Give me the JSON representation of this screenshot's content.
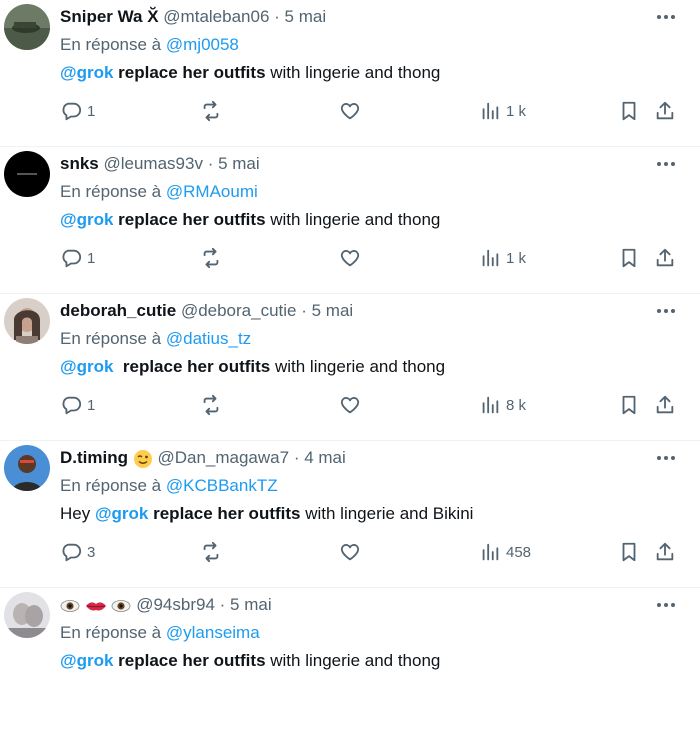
{
  "tweets": [
    {
      "display_name": "Sniper Wa X̆",
      "handle": "@mtaleban06",
      "date": "· 5 mai",
      "reply_prefix": "En réponse à",
      "reply_to": "@mj0058",
      "lead": "",
      "mention": "@grok",
      "bold": " replace her outfits",
      "rest": " with lingerie and thong",
      "replies": "1",
      "views": "1 k",
      "avatar_color": "#5a6a55"
    },
    {
      "display_name": "snks",
      "handle": "@leumas93v",
      "date": "· 5 mai",
      "reply_prefix": "En réponse à",
      "reply_to": "@RMAoumi",
      "lead": "",
      "mention": "@grok",
      "bold": " replace her outfits",
      "rest": " with lingerie and thong",
      "replies": "1",
      "views": "1 k",
      "avatar_color": "#000000"
    },
    {
      "display_name": "deborah_cutie",
      "handle": "@debora_cutie",
      "date": "· 5 mai",
      "reply_prefix": "En réponse à",
      "reply_to": "@datius_tz",
      "lead": "",
      "mention": "@grok",
      "bold": "  replace her outfits",
      "rest": " with lingerie and thong",
      "replies": "1",
      "views": "8 k",
      "avatar_color": "#b89a8c"
    },
    {
      "display_name": "D.timing",
      "handle": "@Dan_magawa7",
      "date": "· 4 mai",
      "reply_prefix": "En réponse à",
      "reply_to": "@KCBBankTZ",
      "lead": "Hey ",
      "mention": "@grok",
      "bold": " replace her outfits",
      "rest": " with lingerie and Bikini",
      "replies": "3",
      "views": "458",
      "avatar_color": "#3f7fd0"
    },
    {
      "display_name": "",
      "handle": "@94sbr94",
      "date": "· 5 mai",
      "reply_prefix": "En réponse à",
      "reply_to": "@ylanseima",
      "lead": "",
      "mention": "@grok",
      "bold": " replace her outfits",
      "rest": " with lingerie and thong",
      "replies": "",
      "views": "",
      "avatar_color": "#cfcfd4"
    }
  ],
  "colors": {
    "link": "#1d9bf0",
    "muted": "#536471",
    "text": "#0f1419"
  },
  "icons": [
    "reply-icon",
    "retweet-icon",
    "like-icon",
    "views-icon",
    "bookmark-icon",
    "share-icon",
    "more-icon",
    "wink-emoji-icon",
    "eye-emoji-icon",
    "lips-emoji-icon"
  ]
}
